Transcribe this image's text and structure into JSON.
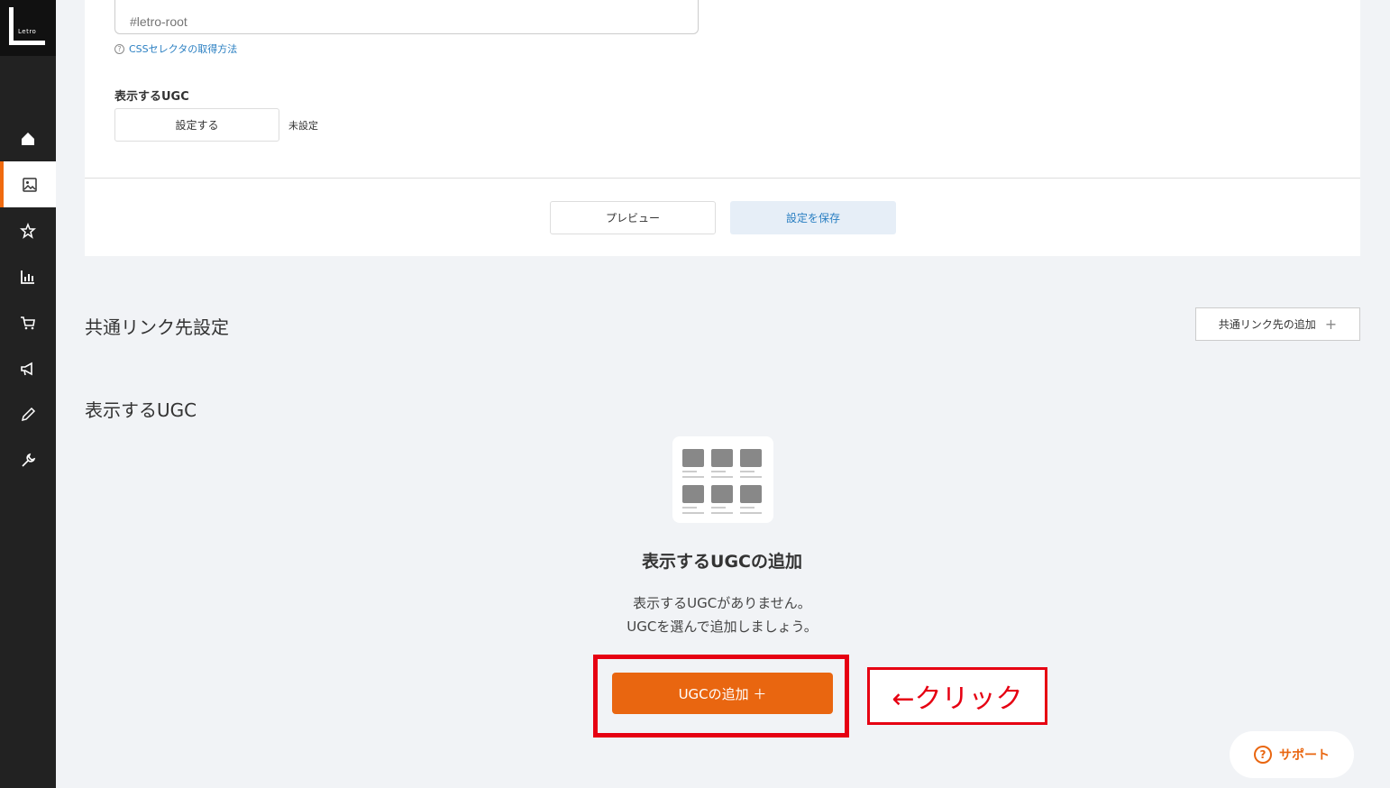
{
  "logo": {
    "text": "Letro"
  },
  "sidebar": {
    "items": [
      {
        "icon": "home-icon",
        "active": false
      },
      {
        "icon": "image-icon",
        "active": true
      },
      {
        "icon": "star-icon",
        "active": false
      },
      {
        "icon": "chart-icon",
        "active": false
      },
      {
        "icon": "cart-icon",
        "active": false
      },
      {
        "icon": "megaphone-icon",
        "active": false
      },
      {
        "icon": "pencil-icon",
        "active": false
      },
      {
        "icon": "wrench-icon",
        "active": false
      }
    ]
  },
  "form": {
    "css_selector_placeholder": "#letro-root",
    "css_help_link": "CSSセレクタの取得方法",
    "display_ugc_label": "表示するUGC",
    "set_button": "設定する",
    "unset_status": "未設定",
    "preview_button": "プレビュー",
    "save_button": "設定を保存"
  },
  "shared_link": {
    "title": "共通リンク先設定",
    "add_button": "共通リンク先の追加",
    "add_icon": "+"
  },
  "ugc_section": {
    "title": "表示するUGC",
    "empty_title": "表示するUGCの追加",
    "empty_line1": "表示するUGCがありません。",
    "empty_line2": "UGCを選んで追加しましょう。",
    "add_button": "UGCの追加 ＋"
  },
  "annotation": {
    "text": "←クリック",
    "color": "#e60012"
  },
  "support": {
    "label": "サポート",
    "icon": "?"
  },
  "colors": {
    "accent": "#e96610",
    "link": "#2a7fc2",
    "sidebar": "#222222"
  }
}
